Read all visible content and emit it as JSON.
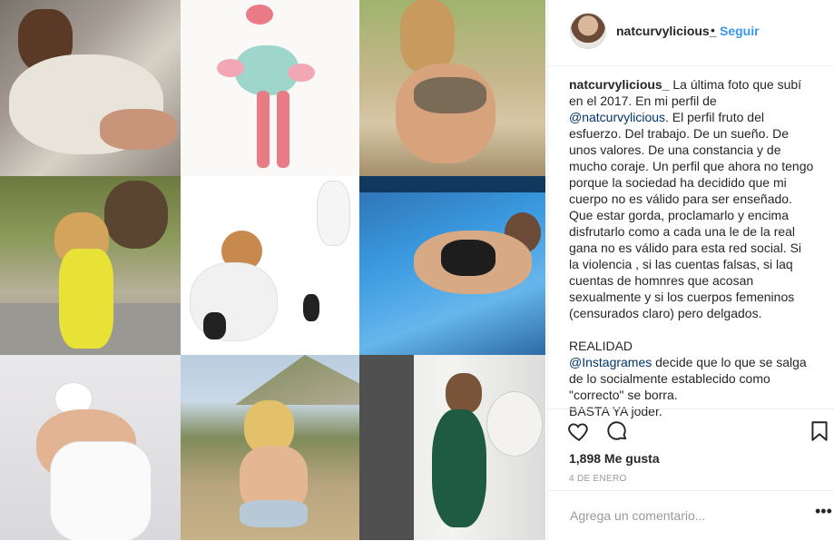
{
  "grid": {
    "tiles": [
      "tile-1",
      "tile-2",
      "tile-3",
      "tile-4",
      "tile-5",
      "tile-6",
      "tile-7",
      "tile-8",
      "tile-9"
    ]
  },
  "header": {
    "username": "natcurvylicious_",
    "dot": "•",
    "follow": "Seguir"
  },
  "caption": {
    "username": "natcurvylicious_",
    "part1": " La última foto que subí en el 2017. En mi perfil de ",
    "mention1": "@natcurvylicious",
    "part2": ". El perfil fruto del esfuerzo. Del trabajo. De un sueño. De unos valores. De una constancia y de mucho coraje. Un perfil que ahora no tengo porque la sociedad ha decidido que mi cuerpo no es válido para ser enseñado. Que estar gorda, proclamarlo y encima disfrutarlo como a cada una le de la real gana no es válido para esta red social. Si la violencia , si las cuentas falsas, si laq cuentas de homnres que acosan sexualmente y si los cuerpos femeninos (censurados claro) pero delgados.\n\nREALIDAD\n",
    "mention2": "@Instagrames",
    "part3": " decide que lo que se salga de lo socialmente establecido como \"correcto\" se borra.\nBASTA YA joder."
  },
  "actions": {
    "likes": "1,898 Me gusta",
    "date": "4 de enero"
  },
  "comment_box": {
    "placeholder": "Agrega un comentario...",
    "more": "•••"
  }
}
